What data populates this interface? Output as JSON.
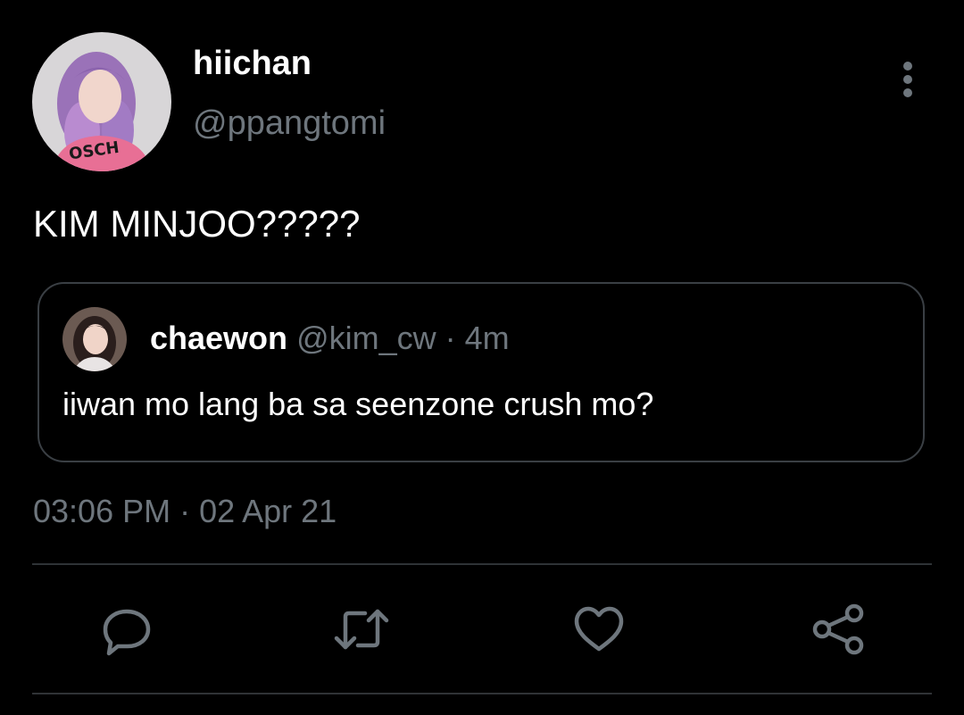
{
  "author": {
    "display_name": "hiichan",
    "handle": "@ppangtomi",
    "avatar_icon": "profile-photo-purple-hair"
  },
  "tweet": {
    "text": "KIM MINJOO?????",
    "timestamp": "03:06 PM · 02 Apr 21"
  },
  "quoted_tweet": {
    "display_name": "chaewon",
    "meta": "@kim_cw · 4m",
    "text": "iiwan mo lang ba sa seenzone crush mo?",
    "avatar_icon": "profile-photo"
  },
  "actions": [
    {
      "icon": "reply-icon"
    },
    {
      "icon": "retweet-icon"
    },
    {
      "icon": "like-icon"
    },
    {
      "icon": "share-icon"
    }
  ],
  "colors": {
    "background": "#000000",
    "primary_text": "#ffffff",
    "secondary_text": "#6e767d",
    "border": "#2f3336"
  }
}
